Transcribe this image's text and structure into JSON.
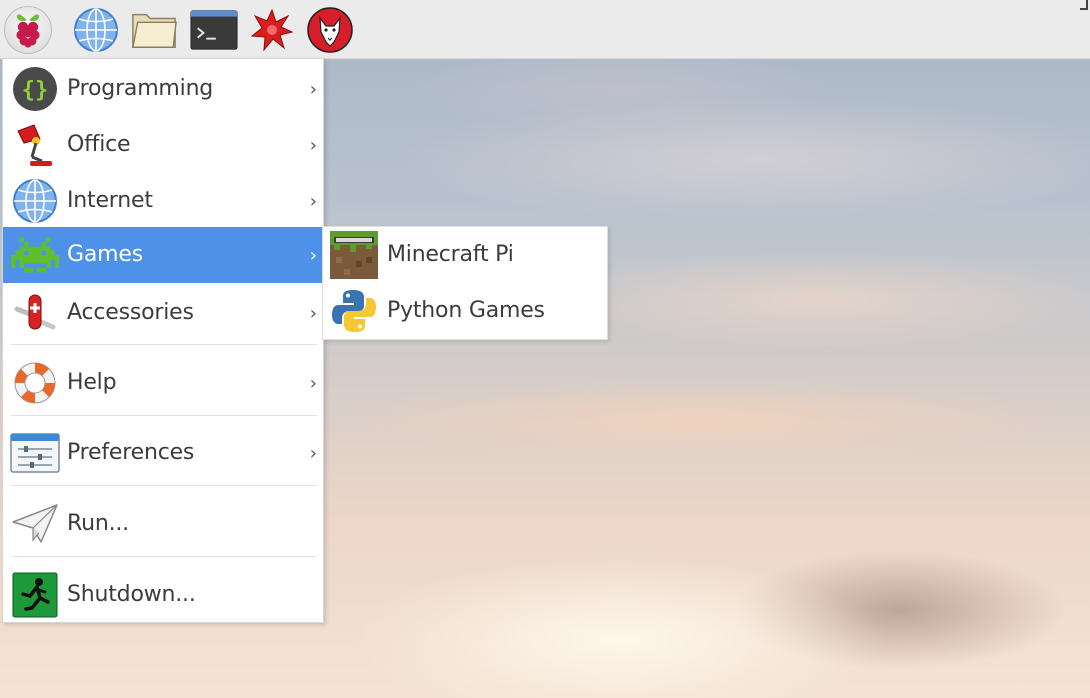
{
  "panel": {
    "launchers": [
      {
        "name": "menu-button",
        "icon": "raspberry-pi-icon"
      },
      {
        "name": "web-browser-launcher",
        "icon": "globe-icon"
      },
      {
        "name": "file-manager-launcher",
        "icon": "folder-icon"
      },
      {
        "name": "terminal-launcher",
        "icon": "terminal-icon"
      },
      {
        "name": "mathematica-launcher",
        "icon": "red-star-icon"
      },
      {
        "name": "wolfram-launcher",
        "icon": "wolf-icon"
      }
    ]
  },
  "main_menu": {
    "items": [
      {
        "label": "Programming",
        "icon": "code-braces-icon",
        "has_submenu": true
      },
      {
        "label": "Office",
        "icon": "desk-lamp-icon",
        "has_submenu": true
      },
      {
        "label": "Internet",
        "icon": "globe-icon",
        "has_submenu": true
      },
      {
        "label": "Games",
        "icon": "space-invader-icon",
        "has_submenu": true,
        "active": true
      },
      {
        "label": "Accessories",
        "icon": "pocket-knife-icon",
        "has_submenu": true
      },
      {
        "label": "Help",
        "icon": "lifebuoy-icon",
        "has_submenu": true
      },
      {
        "label": "Preferences",
        "icon": "settings-window-icon",
        "has_submenu": true
      },
      {
        "label": "Run...",
        "icon": "paper-plane-icon",
        "has_submenu": false
      },
      {
        "label": "Shutdown...",
        "icon": "exit-running-man-icon",
        "has_submenu": false
      }
    ],
    "chevron": "›"
  },
  "games_submenu": {
    "items": [
      {
        "label": "Minecraft Pi",
        "icon": "minecraft-block-icon"
      },
      {
        "label": "Python Games",
        "icon": "python-logo-icon"
      }
    ]
  },
  "colors": {
    "highlight": "#4d92e8",
    "panel_bg": "#ebebeb",
    "menu_bg": "#ffffff"
  }
}
